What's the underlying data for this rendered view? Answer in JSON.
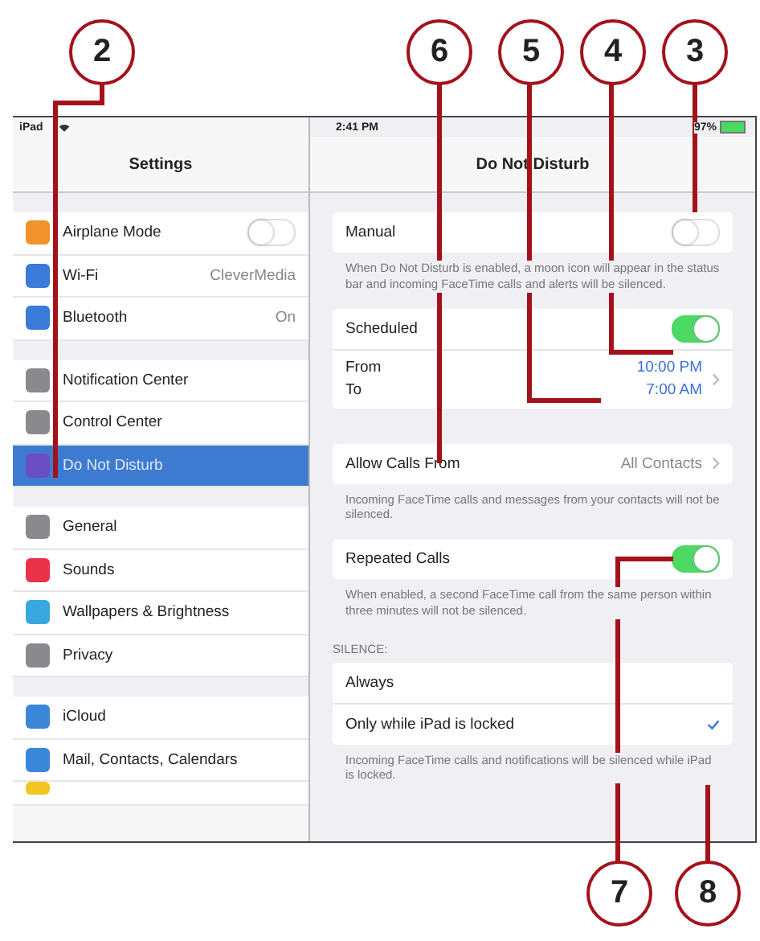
{
  "callouts_top": [
    {
      "label": "2"
    },
    {
      "label": "6"
    },
    {
      "label": "5"
    },
    {
      "label": "4"
    },
    {
      "label": "3"
    }
  ],
  "callouts_bottom": [
    {
      "label": "7"
    },
    {
      "label": "8"
    }
  ],
  "status_bar": {
    "carrier": "iPad",
    "time": "2:41 PM",
    "battery": "97%"
  },
  "sidebar": {
    "title": "Settings",
    "groups": [
      [
        {
          "label": "Airplane Mode",
          "color": "#f0932b",
          "kind": "toggle",
          "on": false,
          "selected": false
        },
        {
          "label": "Wi-Fi",
          "color": "#3a7ad8",
          "kind": "value",
          "value": "CleverMedia",
          "selected": false
        },
        {
          "label": "Bluetooth",
          "color": "#3a7ad8",
          "kind": "value",
          "value": "On",
          "selected": false
        }
      ],
      [
        {
          "label": "Notification Center",
          "color": "#8a8a8e",
          "kind": "plain",
          "selected": false
        },
        {
          "label": "Control Center",
          "color": "#8a8a8e",
          "kind": "plain",
          "selected": false
        },
        {
          "label": "Do Not Disturb",
          "color": "#6a4fc2",
          "kind": "plain",
          "selected": true
        }
      ],
      [
        {
          "label": "General",
          "color": "#8a8a8e",
          "kind": "plain",
          "selected": false
        },
        {
          "label": "Sounds",
          "color": "#e8334a",
          "kind": "plain",
          "selected": false
        },
        {
          "label": "Wallpapers & Brightness",
          "color": "#3aa8e0",
          "kind": "plain",
          "selected": false
        },
        {
          "label": "Privacy",
          "color": "#8a8a8e",
          "kind": "plain",
          "selected": false
        }
      ],
      [
        {
          "label": "iCloud",
          "color": "#3a86d8",
          "kind": "plain",
          "selected": false
        },
        {
          "label": "Mail, Contacts, Calendars",
          "color": "#3a86d8",
          "kind": "plain",
          "selected": false
        }
      ]
    ]
  },
  "detail": {
    "title": "Do Not Disturb",
    "manual": {
      "label": "Manual",
      "on": false,
      "note": "When Do Not Disturb is enabled, a moon icon will appear in the status bar and incoming FaceTime calls and alerts will be silenced."
    },
    "scheduled": {
      "label": "Scheduled",
      "on": true,
      "from_label": "From",
      "to_label": "To",
      "from_time": "10:00 PM",
      "to_time": "7:00 AM"
    },
    "allow_calls": {
      "label": "Allow Calls From",
      "value": "All Contacts",
      "note": "Incoming FaceTime calls and messages from your contacts will not be silenced."
    },
    "repeated": {
      "label": "Repeated Calls",
      "on": true,
      "note": "When enabled, a second FaceTime call from the same person within three minutes will not be silenced."
    },
    "silence": {
      "header": "SILENCE:",
      "options": [
        {
          "label": "Always",
          "selected": false
        },
        {
          "label": "Only while iPad is locked",
          "selected": true
        }
      ],
      "note": "Incoming FaceTime calls and notifications will be silenced while iPad is locked."
    }
  }
}
